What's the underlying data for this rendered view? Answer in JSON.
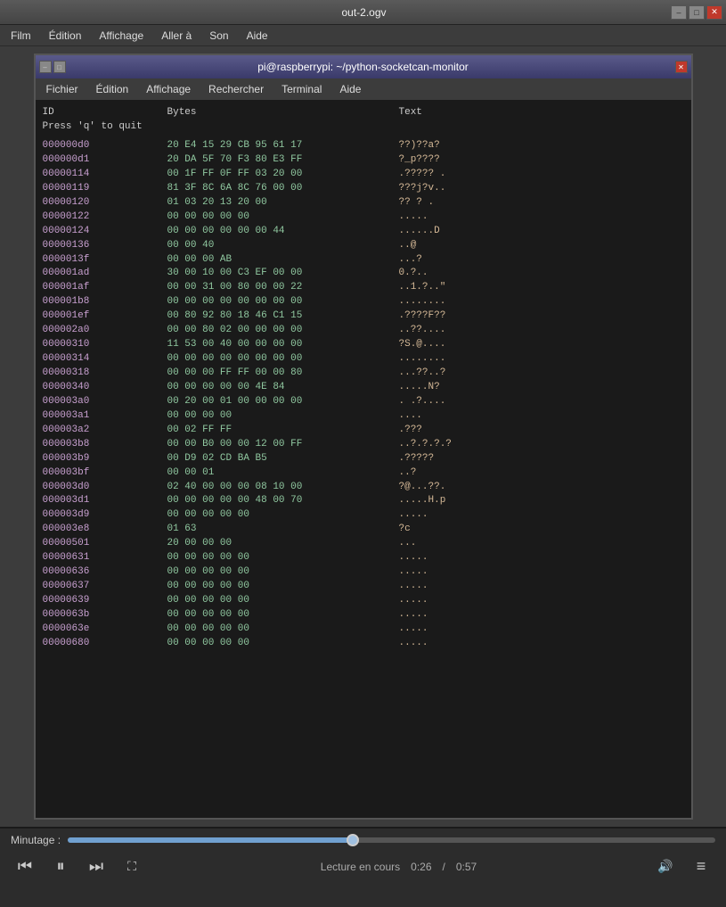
{
  "outer_window": {
    "title": "out-2.ogv",
    "min_label": "–",
    "max_label": "□",
    "close_label": "✕"
  },
  "outer_menu": {
    "items": [
      {
        "label": "Film",
        "id": "film"
      },
      {
        "label": "Édition",
        "id": "edition"
      },
      {
        "label": "Affichage",
        "id": "affichage"
      },
      {
        "label": "Aller à",
        "id": "aller-a"
      },
      {
        "label": "Son",
        "id": "son"
      },
      {
        "label": "Aide",
        "id": "aide"
      }
    ]
  },
  "inner_window": {
    "title": "pi@raspberrypi: ~/python-socketcan-monitor"
  },
  "inner_menu": {
    "items": [
      {
        "label": "Fichier",
        "id": "fichier"
      },
      {
        "label": "Édition",
        "id": "edition"
      },
      {
        "label": "Affichage",
        "id": "affichage"
      },
      {
        "label": "Rechercher",
        "id": "rechercher"
      },
      {
        "label": "Terminal",
        "id": "terminal"
      },
      {
        "label": "Aide",
        "id": "aide"
      }
    ]
  },
  "terminal": {
    "columns": {
      "id": "ID",
      "bytes": "Bytes",
      "text": "Text"
    },
    "quit_message": "Press 'q' to quit",
    "rows": [
      {
        "id": "000000d0",
        "bytes": "20 E4 15 29 CB 95 61 17",
        "text": "??)??a?"
      },
      {
        "id": "000000d1",
        "bytes": "20 DA 5F 70 F3 80 E3 FF",
        "text": "?_p????"
      },
      {
        "id": "00000114",
        "bytes": "00 1F FF 0F FF 03 20 00",
        "text": ".????? ."
      },
      {
        "id": "00000119",
        "bytes": "81 3F 8C 6A 8C 76 00 00",
        "text": "???j?v.."
      },
      {
        "id": "00000120",
        "bytes": "01 03 20 13 20 00",
        "text": "?? ? ."
      },
      {
        "id": "00000122",
        "bytes": "00 00 00 00 00",
        "text": "....."
      },
      {
        "id": "00000124",
        "bytes": "00 00 00 00 00 00 44",
        "text": "......D"
      },
      {
        "id": "00000136",
        "bytes": "00 00 40",
        "text": "..@"
      },
      {
        "id": "0000013f",
        "bytes": "00 00 00 AB",
        "text": "...?"
      },
      {
        "id": "000001ad",
        "bytes": "30 00 10 00 C3 EF 00 00",
        "text": "0.?.."
      },
      {
        "id": "000001af",
        "bytes": "00 00 31 00 80 00 00 22",
        "text": "..1.?..\""
      },
      {
        "id": "000001b8",
        "bytes": "00 00 00 00 00 00 00 00",
        "text": "........"
      },
      {
        "id": "000001ef",
        "bytes": "00 80 92 80 18 46 C1 15",
        "text": ".????F??"
      },
      {
        "id": "000002a0",
        "bytes": "00 00 80 02 00 00 00 00",
        "text": "..??...."
      },
      {
        "id": "00000310",
        "bytes": "11 53 00 40 00 00 00 00",
        "text": "?S.@...."
      },
      {
        "id": "00000314",
        "bytes": "00 00 00 00 00 00 00 00",
        "text": "........"
      },
      {
        "id": "00000318",
        "bytes": "00 00 00 FF FF 00 00 80",
        "text": "...??..?"
      },
      {
        "id": "00000340",
        "bytes": "00 00 00 00 00 4E 84",
        "text": ".....N?"
      },
      {
        "id": "000003a0",
        "bytes": "00 20 00 01 00 00 00 00",
        "text": ". .?...."
      },
      {
        "id": "000003a1",
        "bytes": "00 00 00 00",
        "text": "...."
      },
      {
        "id": "000003a2",
        "bytes": "00 02 FF FF",
        "text": ".???"
      },
      {
        "id": "000003b8",
        "bytes": "00 00 B0 00 00 12 00 FF",
        "text": "..?.?.?.?"
      },
      {
        "id": "000003b9",
        "bytes": "00 D9 02 CD BA B5",
        "text": ".?????"
      },
      {
        "id": "000003bf",
        "bytes": "00 00 01",
        "text": "..?"
      },
      {
        "id": "000003d0",
        "bytes": "02 40 00 00 00 08 10 00",
        "text": "?@...??."
      },
      {
        "id": "000003d1",
        "bytes": "00 00 00 00 00 48 00 70",
        "text": ".....H.p"
      },
      {
        "id": "000003d9",
        "bytes": "00 00 00 00 00",
        "text": "....."
      },
      {
        "id": "000003e8",
        "bytes": "01 63",
        "text": "?c"
      },
      {
        "id": "00000501",
        "bytes": "20 00 00 00",
        "text": "..."
      },
      {
        "id": "00000631",
        "bytes": "00 00 00 00 00",
        "text": "....."
      },
      {
        "id": "00000636",
        "bytes": "00 00 00 00 00",
        "text": "....."
      },
      {
        "id": "00000637",
        "bytes": "00 00 00 00 00",
        "text": "....."
      },
      {
        "id": "00000639",
        "bytes": "00 00 00 00 00",
        "text": "....."
      },
      {
        "id": "0000063b",
        "bytes": "00 00 00 00 00",
        "text": "....."
      },
      {
        "id": "0000063e",
        "bytes": "00 00 00 00 00",
        "text": "....."
      },
      {
        "id": "00000680",
        "bytes": "00 00 00 00 00",
        "text": "....."
      }
    ]
  },
  "player": {
    "progress_label": "Minutage :",
    "progress_pct": 44,
    "status_label": "Lecture en cours",
    "time_current": "0:26",
    "time_total": "0:57",
    "time_separator": "/",
    "btn_prev": "⏮",
    "btn_play": "⏸",
    "btn_next": "⏭",
    "btn_fullscreen": "⛶",
    "btn_volume": "🔊",
    "btn_menu": "≡"
  }
}
